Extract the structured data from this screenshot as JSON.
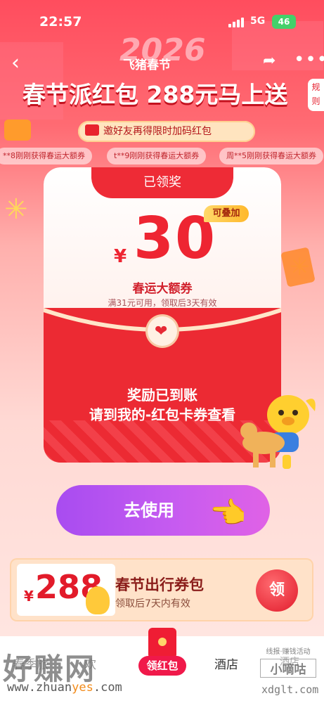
{
  "status_bar": {
    "time": "22:57",
    "network": "5G",
    "battery": "46"
  },
  "header": {
    "year_art": "2026",
    "brand": "飞猪春节",
    "headline": "春节派红包 288元马上送",
    "rules_label": "规则",
    "invite_text": "邀好友再得限时加码红包"
  },
  "ticker": [
    "**8刚刚获得春运大额券",
    "t**9刚刚获得春运大额券",
    "周**5刚刚获得春运大额券"
  ],
  "coupon": {
    "status_tab": "已领奖",
    "currency": "¥",
    "amount": "30",
    "stackable_badge": "可叠加",
    "title": "春运大额券",
    "condition": "满31元可用，领取后3天有效",
    "reward_line1": "奖励已到账",
    "reward_line2": "请到我的-红包卡券查看"
  },
  "use_button": {
    "label": "去使用"
  },
  "travel_pack": {
    "currency": "¥",
    "amount": "288",
    "title": "春节出行券包",
    "subtitle": "领取后7天内有效",
    "claim_label": "领"
  },
  "tab_bar": {
    "left_partial": "春季旅",
    "left_partial2": "欢",
    "center_label": "领红包",
    "hotel_label": "酒店",
    "right_partial": "酒店"
  },
  "watermark": {
    "big": "好赚网",
    "url_prefix": "www.zhuan",
    "url_highlight": "yes",
    "url_suffix": ".com",
    "right_top": "线报·赚钱活动",
    "right_mid": "小嘀咕",
    "right_url": "xdglt.com"
  },
  "colors": {
    "primary_red": "#ec2a33",
    "button_purple": "#b352f0",
    "badge_gold": "#ffc640"
  }
}
